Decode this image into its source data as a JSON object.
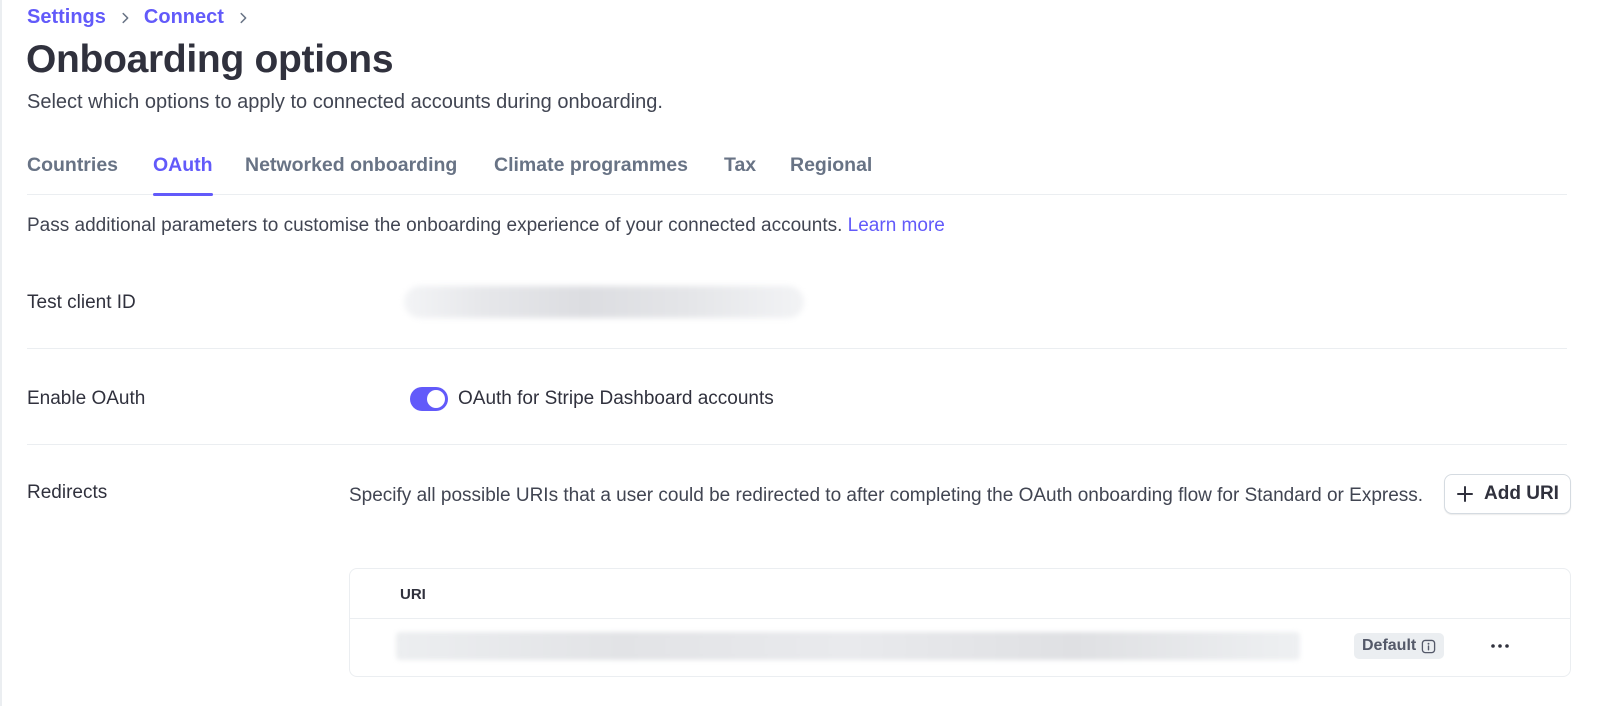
{
  "breadcrumb": {
    "items": [
      "Settings",
      "Connect"
    ]
  },
  "page": {
    "title": "Onboarding options",
    "subtitle": "Select which options to apply to connected accounts during onboarding."
  },
  "tabs": [
    {
      "label": "Countries",
      "active": false
    },
    {
      "label": "OAuth",
      "active": true
    },
    {
      "label": "Networked onboarding",
      "active": false
    },
    {
      "label": "Climate programmes",
      "active": false
    },
    {
      "label": "Tax",
      "active": false
    },
    {
      "label": "Regional",
      "active": false
    }
  ],
  "intro": {
    "text": "Pass additional parameters to customise the onboarding experience of your connected accounts.",
    "link": "Learn more"
  },
  "test_client_id": {
    "label": "Test client ID"
  },
  "enable_oauth": {
    "label": "Enable OAuth",
    "toggle_on": true,
    "toggle_label": "OAuth for Stripe Dashboard accounts"
  },
  "redirects": {
    "label": "Redirects",
    "description": "Specify all possible URIs that a user could be redirected to after completing the OAuth onboarding flow for Standard or Express.",
    "add_button": "Add URI",
    "table": {
      "header": "URI",
      "rows": [
        {
          "badge": "Default"
        }
      ]
    }
  },
  "colors": {
    "accent": "#625afa",
    "text": "#30313d",
    "muted": "#687385",
    "border": "#ebeef1"
  },
  "icons": [
    "chevron-right-icon",
    "plus-icon",
    "info-icon",
    "more-horizontal-icon"
  ]
}
